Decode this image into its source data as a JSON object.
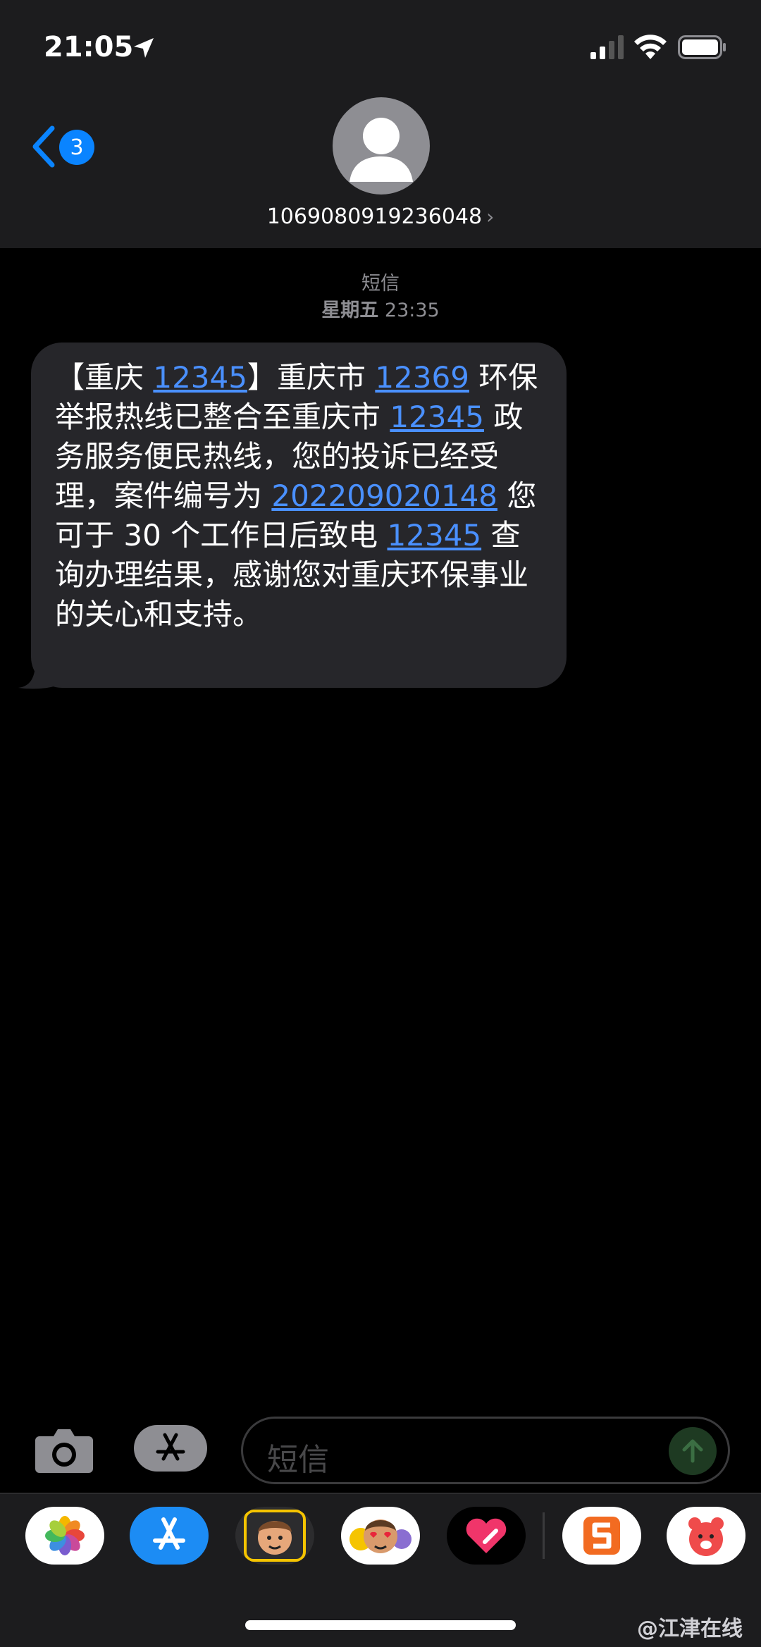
{
  "status_bar": {
    "time": "21:05",
    "icons": [
      "location-arrow-icon",
      "cellular-signal-icon",
      "wifi-icon",
      "battery-icon"
    ]
  },
  "header": {
    "back_badge": "3",
    "contact": "1069080919236048",
    "contact_chevron": "›"
  },
  "conversation": {
    "service_label": "短信",
    "day": "星期五",
    "time": "23:35",
    "message": {
      "segments": [
        {
          "text": "【重庆 ",
          "link": false
        },
        {
          "text": "12345",
          "link": true
        },
        {
          "text": "】重庆市 ",
          "link": false
        },
        {
          "text": "12369",
          "link": true
        },
        {
          "text": " 环保举报热线已整合至重庆市 ",
          "link": false
        },
        {
          "text": "12345",
          "link": true
        },
        {
          "text": " 政务服务便民热线，您的投诉已经受理，案件编号为 ",
          "link": false
        },
        {
          "text": "202209020148",
          "link": true
        },
        {
          "text": " 您可于 30 个工作日后致电 ",
          "link": false
        },
        {
          "text": "12345",
          "link": true
        },
        {
          "text": " 查询办理结果，感谢您对重庆环保事业的关心和支持。",
          "link": false
        }
      ]
    }
  },
  "input_bar": {
    "placeholder": "短信"
  },
  "app_drawer": {
    "apps": [
      "photos-app-icon",
      "app-store-icon",
      "memoji-icon",
      "animoji-stickers-icon",
      "digital-touch-icon",
      "sogou-keyboard-icon",
      "red-bear-app-icon"
    ]
  },
  "watermark": "@江津在线",
  "colors": {
    "link": "#4a90ff",
    "badge": "#0a84ff",
    "bubble": "#26262a",
    "bar": "#1c1c1e"
  }
}
